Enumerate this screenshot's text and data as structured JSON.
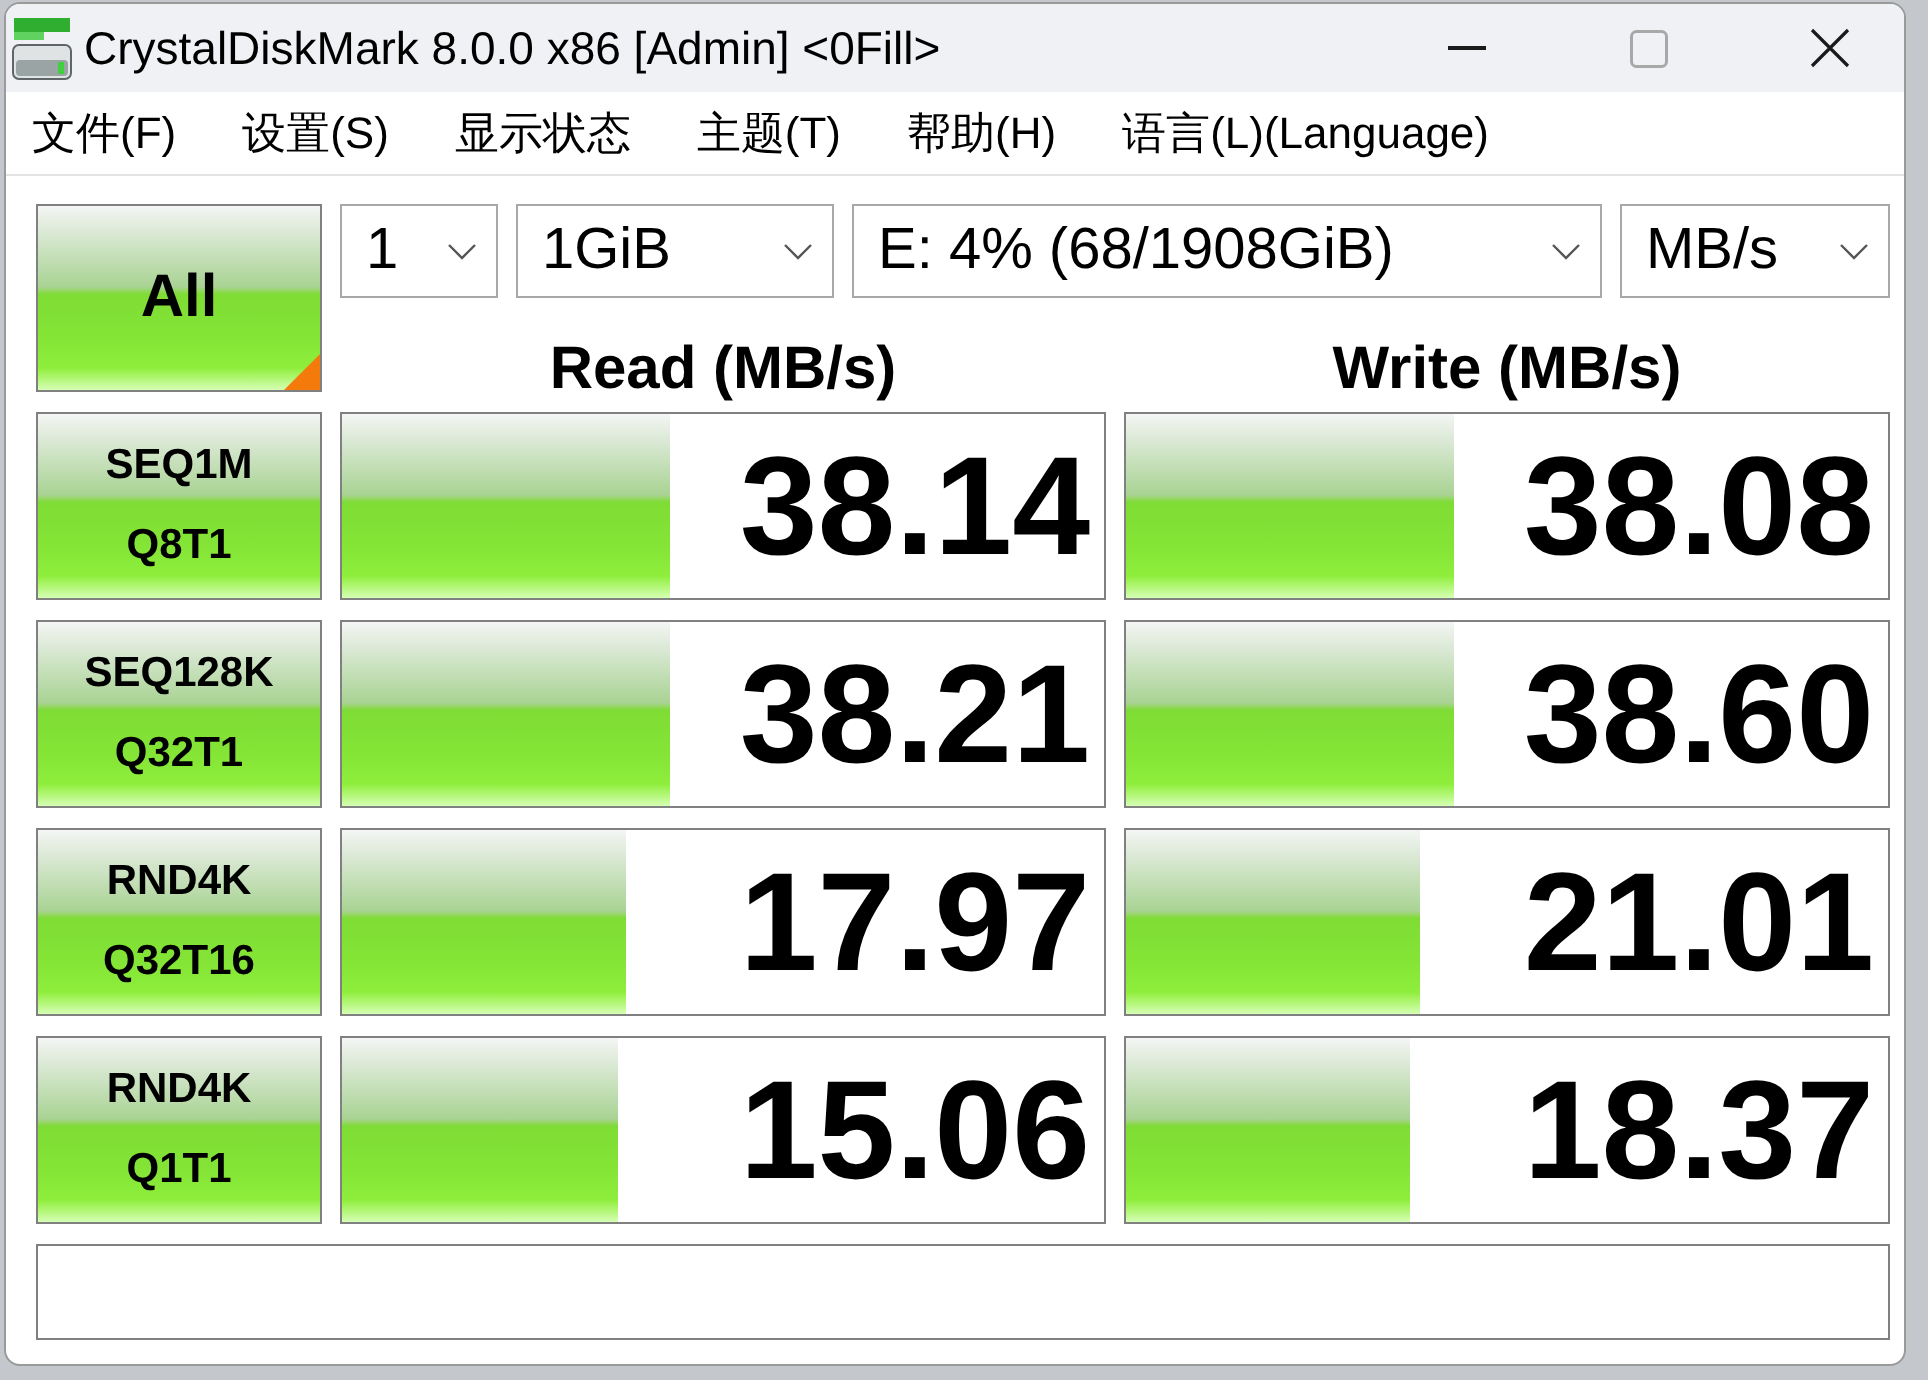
{
  "window": {
    "title": "CrystalDiskMark 8.0.0 x86 [Admin] <0Fill>",
    "maximize_disabled": true
  },
  "menu": [
    {
      "label": "文件(F)"
    },
    {
      "label": "设置(S)"
    },
    {
      "label": "显示状态"
    },
    {
      "label": "主题(T)"
    },
    {
      "label": "帮助(H)"
    },
    {
      "label": "语言(L)(Language)"
    }
  ],
  "all_button": {
    "label": "All"
  },
  "dropdowns": [
    {
      "value": "1"
    },
    {
      "value": "1GiB"
    },
    {
      "value": "E: 4% (68/1908GiB)"
    },
    {
      "value": "MB/s"
    }
  ],
  "columns": [
    "Read (MB/s)",
    "Write (MB/s)"
  ],
  "tests": [
    {
      "name": "SEQ1M",
      "params": "Q8T1",
      "read": {
        "value": "38.14",
        "level": 0.43
      },
      "write": {
        "value": "38.08",
        "level": 0.43
      }
    },
    {
      "name": "SEQ128K",
      "params": "Q32T1",
      "read": {
        "value": "38.21",
        "level": 0.43
      },
      "write": {
        "value": "38.60",
        "level": 0.43
      }
    },
    {
      "name": "RND4K",
      "params": "Q32T16",
      "read": {
        "value": "17.97",
        "level": 0.374
      },
      "write": {
        "value": "21.01",
        "level": 0.385
      }
    },
    {
      "name": "RND4K",
      "params": "Q1T1",
      "read": {
        "value": "15.06",
        "level": 0.361
      },
      "write": {
        "value": "18.37",
        "level": 0.374
      }
    }
  ]
}
